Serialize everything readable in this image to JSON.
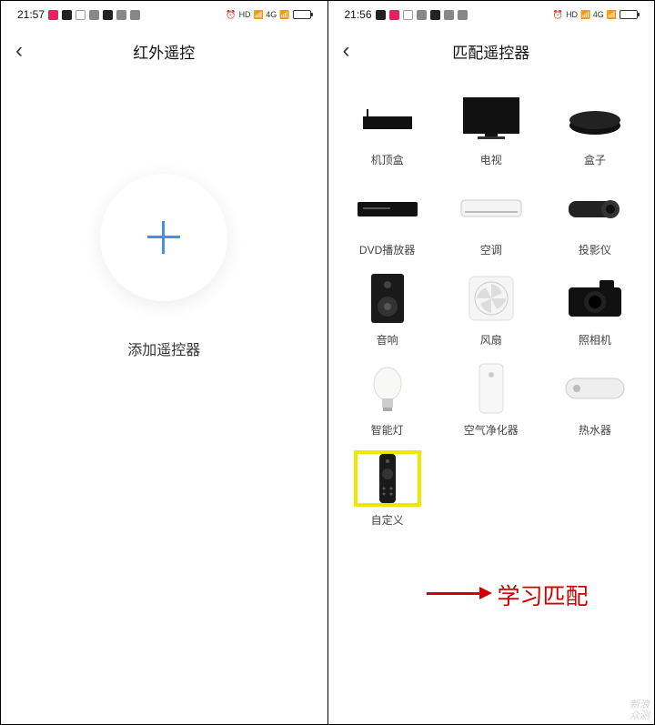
{
  "left": {
    "time": "21:57",
    "title": "红外遥控",
    "add_label": "添加遥控器"
  },
  "right": {
    "time": "21:56",
    "title": "匹配遥控器",
    "devices": [
      {
        "label": "机顶盒"
      },
      {
        "label": "电视"
      },
      {
        "label": "盒子"
      },
      {
        "label": "DVD播放器"
      },
      {
        "label": "空调"
      },
      {
        "label": "投影仪"
      },
      {
        "label": "音响"
      },
      {
        "label": "风扇"
      },
      {
        "label": "照相机"
      },
      {
        "label": "智能灯"
      },
      {
        "label": "空气净化器"
      },
      {
        "label": "热水器"
      },
      {
        "label": "自定义"
      }
    ]
  },
  "annotation": "学习匹配",
  "watermark": "新浪\n众测"
}
